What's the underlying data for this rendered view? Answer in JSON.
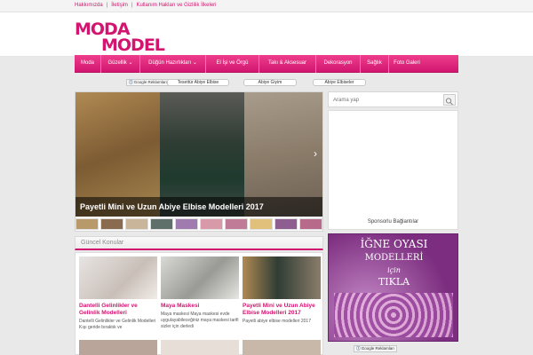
{
  "toplinks": [
    "Hakkımızda",
    "İletişim",
    "Kullanım Hakları ve Gizlilik İlkeleri"
  ],
  "logo": {
    "line1": "MODA",
    "line2": "MODEL"
  },
  "nav": [
    {
      "label": "Moda"
    },
    {
      "label": "Güzellik ⌄"
    },
    {
      "label": "Düğün Hazırlıkları ⌄"
    },
    {
      "label": "El İşi ve Örgü"
    },
    {
      "label": "Takı & Aksesuar"
    },
    {
      "label": "Dekorasyon"
    },
    {
      "label": "Sağlık"
    },
    {
      "label": "Foto Galeri"
    }
  ],
  "strip": {
    "badge": "Google Reklamları",
    "links": [
      "Tesettür Abiye Elbise",
      "Abiye Giyim",
      "Abiye Elbiseler"
    ]
  },
  "slider": {
    "caption": "Payetli Mini ve Uzun Abiye Elbise Modelleri 2017"
  },
  "section": {
    "title": "Güncel Konular"
  },
  "posts": [
    {
      "title": "Dantelli Gelinlikler ve Gelinlik Modelleri",
      "excerpt": "Dantelli Gelinlikler ve Gelinlik Modelleri Kışı geride bıraktık ve"
    },
    {
      "title": "Maya Maskesi",
      "excerpt": "Maya maskesi Maya maskesi evde uygulayabileceğiniz maya maskesi tarifi sizler için derledi"
    },
    {
      "title": "Payetli Mini ve Uzun Abiye Elbise Modelleri 2017",
      "excerpt": "Payetli abiye elbise modelleri 2017"
    }
  ],
  "search": {
    "placeholder": "Arama yap"
  },
  "sponsor": "Sponsorlu Bağlantılar",
  "banner": {
    "l1": "İĞNE OYASI",
    "l2": "MODELLERİ",
    "l3": "için",
    "l4": "TIKLA"
  },
  "google_badge": "Google Reklamları",
  "colors": {
    "brand": "#d2166f",
    "nav_top": "#ee3d8c",
    "nav_bottom": "#d21670"
  }
}
